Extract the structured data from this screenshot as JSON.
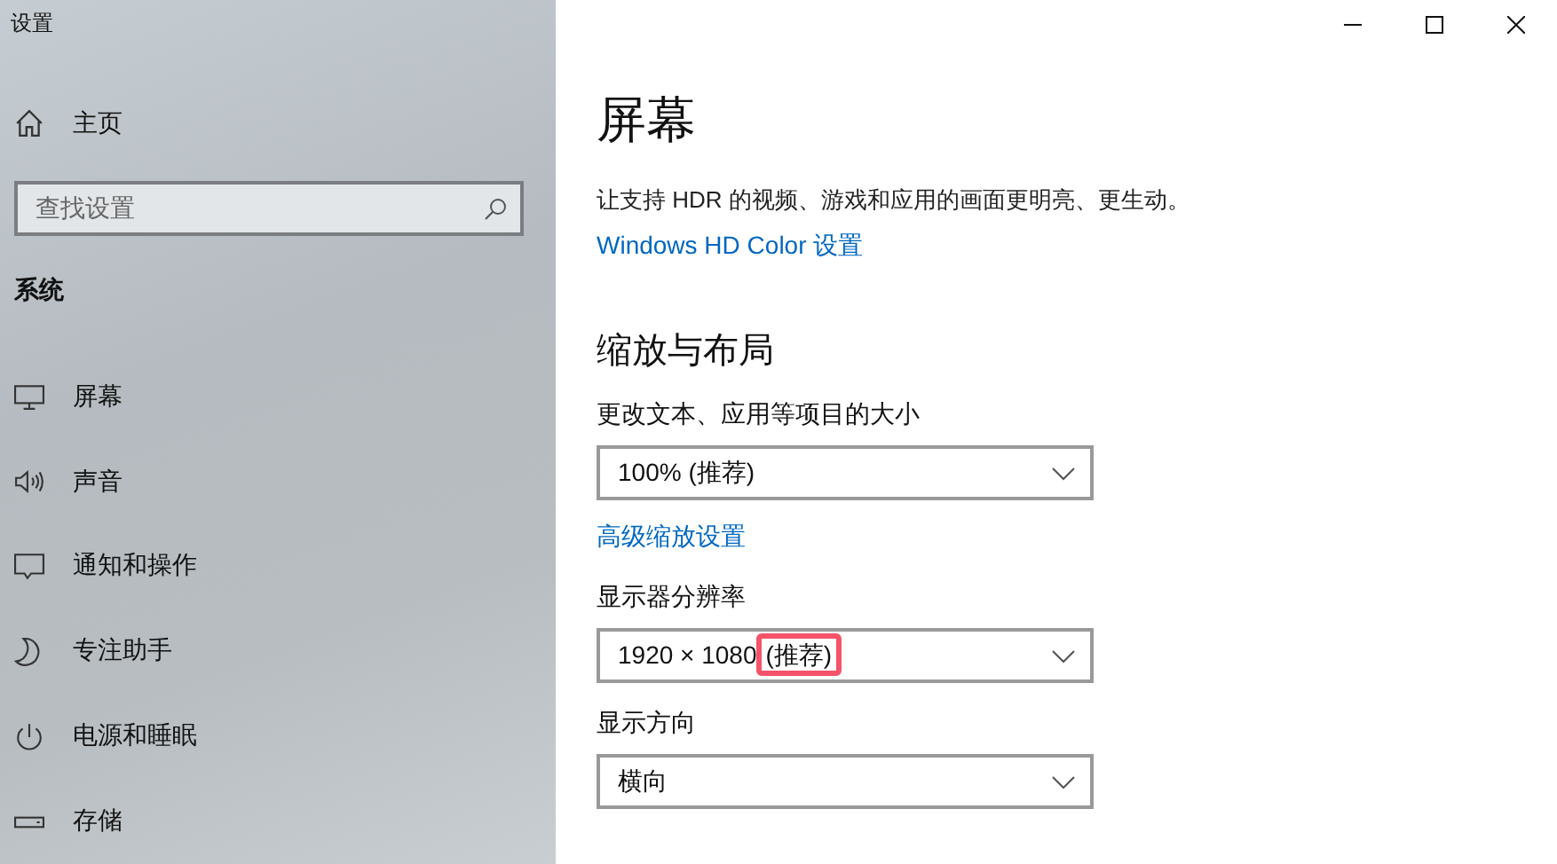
{
  "window": {
    "title": "设置"
  },
  "sidebar": {
    "home": "主页",
    "search": {
      "placeholder": "查找设置"
    },
    "section": "系统",
    "items": [
      {
        "label": "屏幕",
        "selected": false
      },
      {
        "label": "声音",
        "selected": false
      },
      {
        "label": "通知和操作",
        "selected": false
      },
      {
        "label": "专注助手",
        "selected": false
      },
      {
        "label": "电源和睡眠",
        "selected": false
      },
      {
        "label": "存储",
        "selected": false
      }
    ]
  },
  "page": {
    "title": "屏幕",
    "description": "让支持 HDR 的视频、游戏和应用的画面更明亮、更生动。",
    "link": "Windows HD Color 设置",
    "section": "缩放与布局",
    "settings": [
      {
        "kind": "dropdown",
        "label": "更改文本、应用等项目的大小",
        "value": "100% (推荐)"
      },
      {
        "kind": "link",
        "text": "高级缩放设置"
      },
      {
        "kind": "dropdown",
        "label": "显示器分辨率",
        "value": "1920 × 1080",
        "note": "(推荐)",
        "note_highlighted": true
      },
      {
        "kind": "dropdown",
        "label": "显示方向",
        "value": "横向"
      }
    ]
  }
}
